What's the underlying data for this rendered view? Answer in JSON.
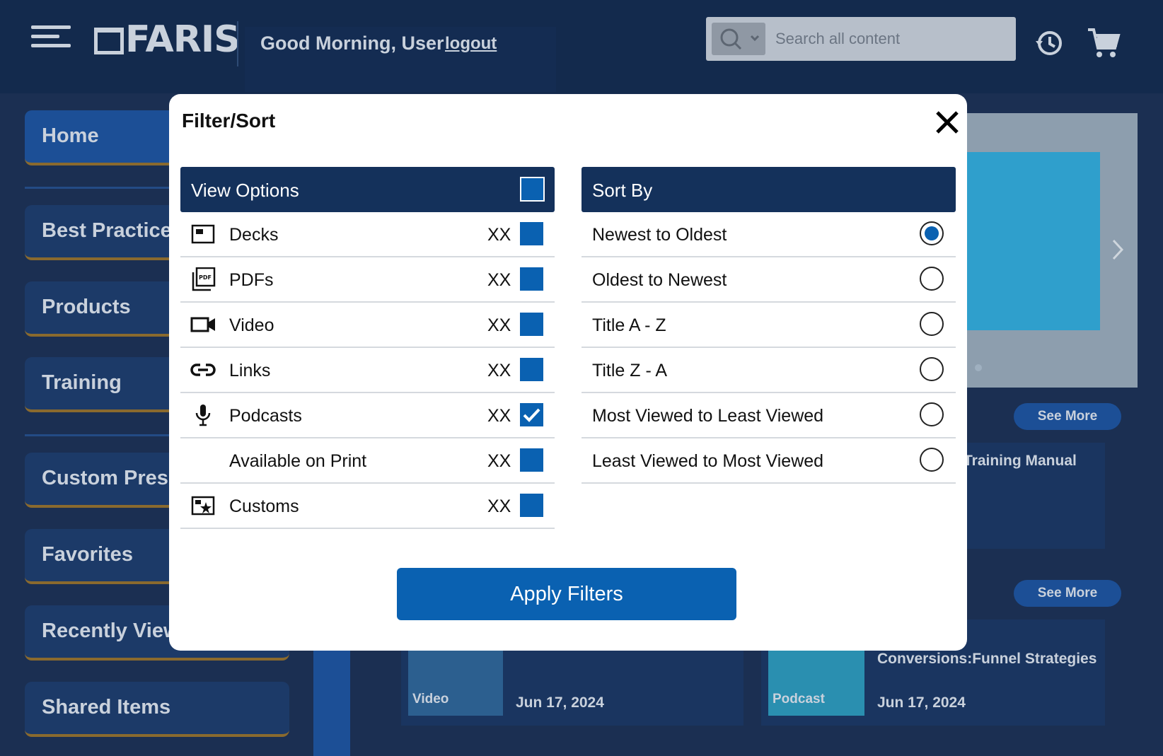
{
  "header": {
    "logo_text": "FARIS",
    "greeting": "Good Morning, User",
    "logout_label": "logout",
    "search_placeholder": "Search all content",
    "icons": [
      "menu-icon",
      "search-icon",
      "chevron-down-icon",
      "history-icon",
      "cart-icon"
    ]
  },
  "sidebar": {
    "items": [
      {
        "label": "Home"
      },
      {
        "label": "Best Practices"
      },
      {
        "label": "Products"
      },
      {
        "label": "Training"
      },
      {
        "label": "Custom Presentations"
      },
      {
        "label": "Favorites"
      },
      {
        "label": "Recently Viewed"
      },
      {
        "label": "Shared Items"
      }
    ]
  },
  "content": {
    "see_more_label": "See More",
    "cards": [
      {
        "title": "Training Manual"
      },
      {
        "title": "Conversions:Funnel Strategies",
        "type": "Podcast",
        "date": "Jun 17, 2024"
      },
      {
        "type": "Video",
        "date": "Jun 17, 2024"
      }
    ]
  },
  "modal": {
    "title": "Filter/Sort",
    "close_icon": "close-icon",
    "view_options": {
      "header": "View Options",
      "items": [
        {
          "label": "Decks",
          "count": "XX",
          "icon": "deck-icon",
          "checked": false
        },
        {
          "label": "PDFs",
          "count": "XX",
          "icon": "pdf-icon",
          "checked": false
        },
        {
          "label": "Video",
          "count": "XX",
          "icon": "video-camera-icon",
          "checked": false
        },
        {
          "label": "Links",
          "count": "XX",
          "icon": "link-icon",
          "checked": false
        },
        {
          "label": "Podcasts",
          "count": "XX",
          "icon": "microphone-icon",
          "checked": true
        },
        {
          "label": "Available on Print",
          "count": "XX",
          "icon": "",
          "checked": false
        },
        {
          "label": "Customs",
          "count": "XX",
          "icon": "custom-star-icon",
          "checked": false
        }
      ]
    },
    "sort_by": {
      "header": "Sort By",
      "options": [
        {
          "label": "Newest to Oldest",
          "selected": true
        },
        {
          "label": "Oldest to Newest",
          "selected": false
        },
        {
          "label": "Title A - Z",
          "selected": false
        },
        {
          "label": "Title Z - A",
          "selected": false
        },
        {
          "label": "Most Viewed to Least Viewed",
          "selected": false
        },
        {
          "label": "Least Viewed to Most Viewed",
          "selected": false
        }
      ]
    },
    "apply_label": "Apply Filters"
  },
  "colors": {
    "accent": "#0a61b1",
    "panel_header": "#14315b",
    "background": "#1b2f52"
  }
}
